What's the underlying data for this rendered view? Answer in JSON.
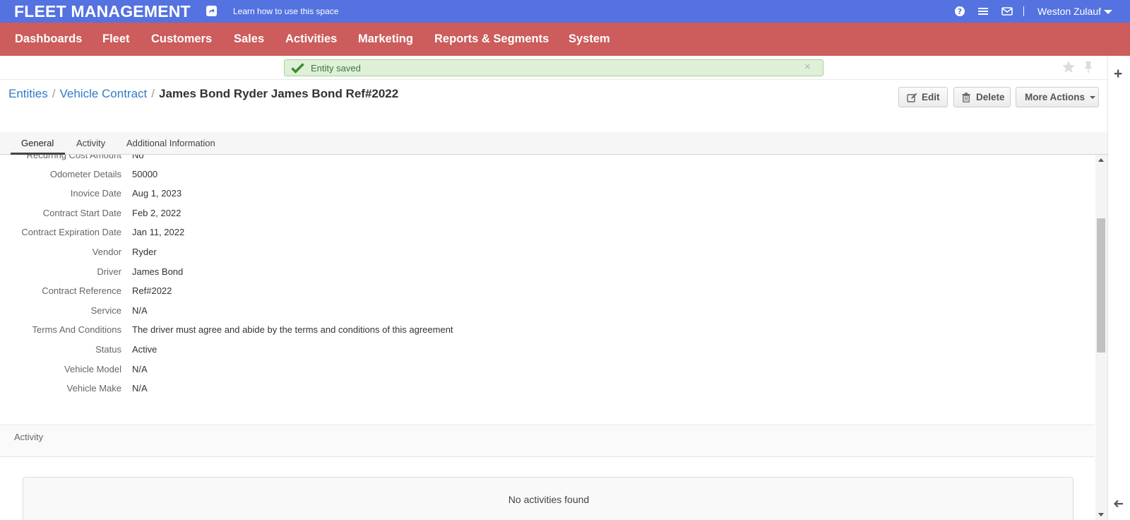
{
  "topbar": {
    "app_title": "FLEET MANAGEMENT",
    "learn_link": "Learn how to use this space",
    "user_name": "Weston Zulauf"
  },
  "nav": {
    "items": [
      "Dashboards",
      "Fleet",
      "Customers",
      "Sales",
      "Activities",
      "Marketing",
      "Reports & Segments",
      "System"
    ]
  },
  "alert": {
    "message": "Entity saved",
    "close": "×"
  },
  "breadcrumb": {
    "items": [
      "Entities",
      "Vehicle Contract"
    ],
    "current": "James Bond Ryder James Bond Ref#2022",
    "separator": "/"
  },
  "actions": {
    "edit": "Edit",
    "delete": "Delete",
    "more": "More Actions"
  },
  "tabs": [
    "General",
    "Activity",
    "Additional Information"
  ],
  "fields": [
    {
      "label": "Recurring Cost Amount",
      "value": "No"
    },
    {
      "label": "Odometer Details",
      "value": "50000"
    },
    {
      "label": "Inovice Date",
      "value": "Aug 1, 2023"
    },
    {
      "label": "Contract Start Date",
      "value": "Feb 2, 2022"
    },
    {
      "label": "Contract Expiration Date",
      "value": "Jan 11, 2022"
    },
    {
      "label": "Vendor",
      "value": "Ryder"
    },
    {
      "label": "Driver",
      "value": "James Bond"
    },
    {
      "label": "Contract Reference",
      "value": "Ref#2022"
    },
    {
      "label": "Service",
      "value": "N/A"
    },
    {
      "label": "Terms And Conditions",
      "value": "The driver must agree and abide by the terms and conditions of this agreement"
    },
    {
      "label": "Status",
      "value": "Active"
    },
    {
      "label": "Vehicle Model",
      "value": "N/A"
    },
    {
      "label": "Vehicle Make",
      "value": "N/A"
    }
  ],
  "activity": {
    "title": "Activity",
    "empty": "No activities found"
  },
  "colors": {
    "topbar": "#5472e0",
    "nav": "#cd5c5c",
    "link": "#2f7bc9",
    "alert_bg": "#dff0d8"
  }
}
